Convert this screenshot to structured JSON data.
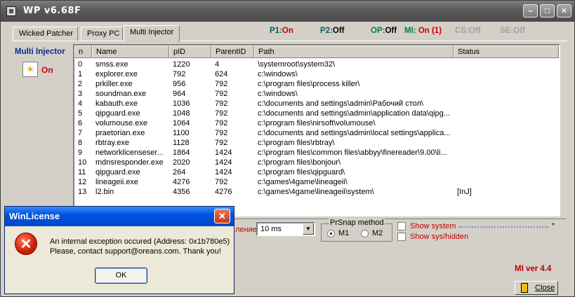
{
  "window": {
    "title": "WP v6.68F"
  },
  "tabs": [
    {
      "label": "Wicked Patcher",
      "active": false
    },
    {
      "label": "Proxy PC",
      "active": false
    },
    {
      "label": "Multi Injector",
      "active": true
    }
  ],
  "status": {
    "p1": {
      "label": "P1:",
      "value": "On"
    },
    "p2": {
      "label": "P2:",
      "value": "Off"
    },
    "op": {
      "label": "OP:",
      "value": "Off"
    },
    "mi": {
      "label": "MI:",
      "value": "On (1)"
    },
    "cs": "CS:Off",
    "se": "SE:Off"
  },
  "left_pane": {
    "title": "Multi Injector",
    "state": "On"
  },
  "process_list": {
    "columns": [
      "n",
      "Name",
      "pID",
      "ParentID",
      "Path",
      "Status"
    ],
    "rows": [
      [
        "0",
        "smss.exe",
        "1220",
        "4",
        "\\systemroot\\system32\\",
        ""
      ],
      [
        "1",
        "explorer.exe",
        "792",
        "624",
        "c:\\windows\\",
        ""
      ],
      [
        "2",
        "prkiller.exe",
        "956",
        "792",
        "c:\\program files\\process killer\\",
        ""
      ],
      [
        "3",
        "soundman.exe",
        "964",
        "792",
        "c:\\windows\\",
        ""
      ],
      [
        "4",
        "kabauth.exe",
        "1036",
        "792",
        "c:\\documents and settings\\admin\\Рабочий стол\\",
        ""
      ],
      [
        "5",
        "qipguard.exe",
        "1048",
        "792",
        "c:\\documents and settings\\admin\\application data\\qipg...",
        ""
      ],
      [
        "6",
        "volumouse.exe",
        "1064",
        "792",
        "c:\\program files\\nirsoft\\volumouse\\",
        ""
      ],
      [
        "7",
        "praetorian.exe",
        "1100",
        "792",
        "c:\\documents and settings\\admin\\local settings\\applica...",
        ""
      ],
      [
        "8",
        "rbtray.exe",
        "1128",
        "792",
        "c:\\program files\\rbtray\\",
        ""
      ],
      [
        "9",
        "networklicenseser...",
        "1864",
        "1424",
        "c:\\program files\\common files\\abbyy\\finereader\\9.00\\li...",
        ""
      ],
      [
        "10",
        "mdnsresponder.exe",
        "2020",
        "1424",
        "c:\\program files\\bonjour\\",
        ""
      ],
      [
        "11",
        "qipguard.exe",
        "264",
        "1424",
        "c:\\program files\\qipguard\\",
        ""
      ],
      [
        "12",
        "lineageii.exe",
        "4276",
        "792",
        "c:\\games\\4game\\lineageii\\",
        ""
      ],
      [
        "13",
        "l2.bin",
        "4356",
        "4276",
        "c:\\games\\4game\\lineageii\\system\\",
        "[InJ]"
      ]
    ]
  },
  "controls": {
    "delay_label": "ление:",
    "delay_value": "10 ms",
    "prsnap": {
      "label": "PrSnap method",
      "m1": "M1",
      "m2": "M2",
      "selected": "M1"
    },
    "show_system": "Show system",
    "show_hidden": "Show sys/hidden",
    "star": "*",
    "version": "MI ver 4.4",
    "close": "Close"
  },
  "dialog": {
    "title": "WinLicense",
    "line1": "An internal exception occured (Address: 0x1b780e5)",
    "line2": "Please, contact support@oreans.com. Thank you!",
    "ok": "OK"
  },
  "colors": {
    "on": "#d00000",
    "off": "#000000",
    "title_bar": "#5a5a5a",
    "dialog_title": "#0054e3"
  }
}
